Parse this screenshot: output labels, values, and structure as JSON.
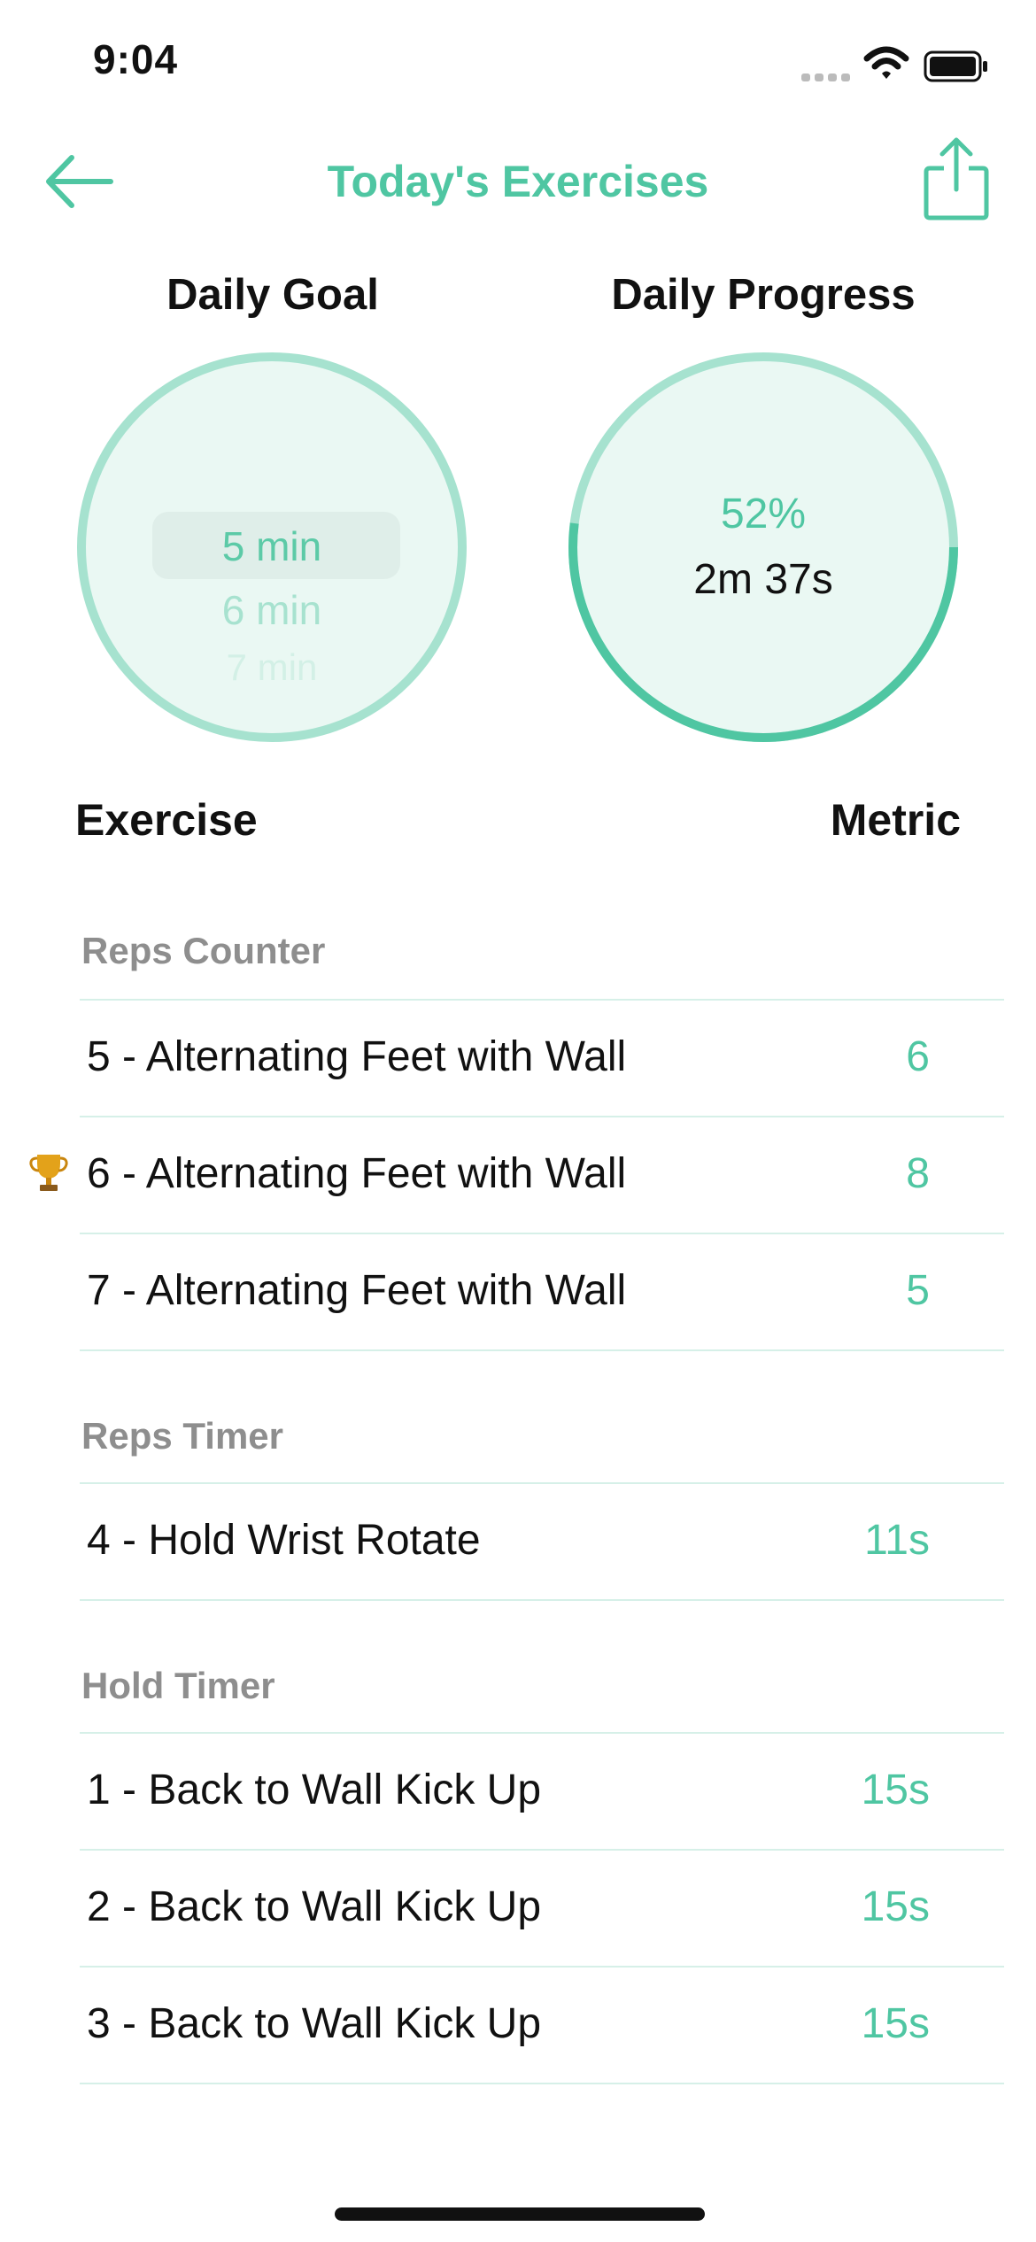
{
  "status_bar": {
    "time": "9:04",
    "icons": [
      "signal-icon",
      "wifi-icon",
      "battery-icon"
    ]
  },
  "nav": {
    "title": "Today's Exercises",
    "back_icon": "arrow-left-icon",
    "share_icon": "share-icon"
  },
  "daily_goal": {
    "title": "Daily Goal",
    "picker_selected": "5 min",
    "picker_next": "6 min",
    "picker_next2": "7 min"
  },
  "daily_progress": {
    "title": "Daily Progress",
    "percent_label": "52%",
    "percent_value": 0.52,
    "time": "2m 37s"
  },
  "table_header": {
    "exercise": "Exercise",
    "metric": "Metric"
  },
  "sections": [
    {
      "title": "Reps Counter",
      "rows": [
        {
          "label": "5 - Alternating Feet with Wall",
          "value": "6",
          "trophy": false
        },
        {
          "label": "6 - Alternating Feet with Wall",
          "value": "8",
          "trophy": true
        },
        {
          "label": "7 - Alternating Feet with Wall",
          "value": "5",
          "trophy": false
        }
      ]
    },
    {
      "title": "Reps Timer",
      "rows": [
        {
          "label": "4 - Hold Wrist Rotate",
          "value": "11s",
          "trophy": false
        }
      ]
    },
    {
      "title": "Hold Timer",
      "rows": [
        {
          "label": "1 - Back to Wall Kick Up",
          "value": "15s",
          "trophy": false
        },
        {
          "label": "2 - Back to Wall Kick Up",
          "value": "15s",
          "trophy": false
        },
        {
          "label": "3 - Back to Wall Kick Up",
          "value": "15s",
          "trophy": false
        }
      ]
    }
  ],
  "colors": {
    "accent": "#4fc6a2",
    "accent_light": "#a6e2cf",
    "circle_fill": "#eaf8f3",
    "section_title": "#8e8e8e"
  }
}
